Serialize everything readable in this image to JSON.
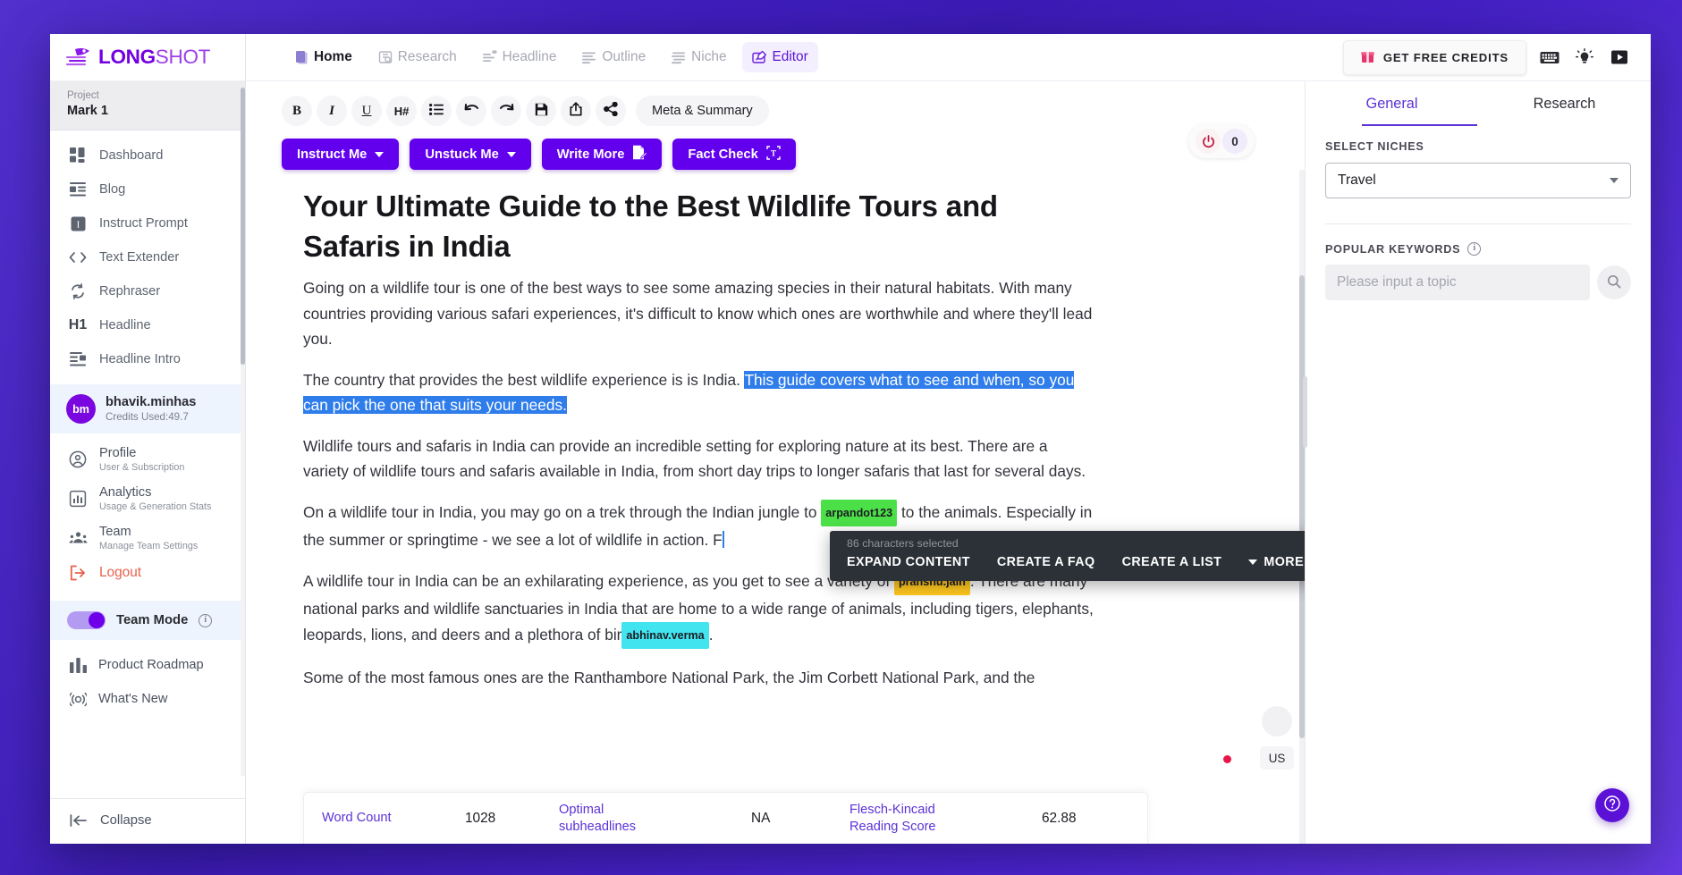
{
  "brand": {
    "name_bold": "LONG",
    "name_light": "SHOT",
    "accent": "#7200e0"
  },
  "sidebar": {
    "project_label": "Project",
    "project_name": "Mark 1",
    "nav": [
      {
        "label": "Dashboard",
        "icon": "dashboard-icon"
      },
      {
        "label": "Blog",
        "icon": "blog-icon"
      },
      {
        "label": "Instruct Prompt",
        "icon": "instruct-prompt-icon"
      },
      {
        "label": "Text Extender",
        "icon": "code-brackets-icon"
      },
      {
        "label": "Rephraser",
        "icon": "refresh-icon"
      },
      {
        "label": "Headline",
        "icon": "h1-icon"
      },
      {
        "label": "Headline Intro",
        "icon": "headline-intro-icon"
      }
    ],
    "user": {
      "initials": "bm",
      "name": "bhavik.minhas",
      "credits": "Credits Used:49.7"
    },
    "account": [
      {
        "title": "Profile",
        "subtitle": "User & Subscription",
        "icon": "user-circle-icon"
      },
      {
        "title": "Analytics",
        "subtitle": "Usage & Generation Stats",
        "icon": "chart-box-icon"
      },
      {
        "title": "Team",
        "subtitle": "Manage Team Settings",
        "icon": "team-icon"
      }
    ],
    "logout": {
      "title": "Logout",
      "icon": "logout-icon"
    },
    "team_mode": {
      "label": "Team Mode",
      "enabled": true
    },
    "bottom": [
      {
        "label": "Product Roadmap",
        "icon": "roadmap-icon"
      },
      {
        "label": "What's New",
        "icon": "megaphone-icon"
      }
    ],
    "collapse": {
      "label": "Collapse",
      "icon": "arrow-left-bar-icon"
    }
  },
  "topbar": {
    "tabs": [
      {
        "label": "Home",
        "icon": "home-icon",
        "state": "home"
      },
      {
        "label": "Research",
        "icon": "research-icon",
        "state": "idle"
      },
      {
        "label": "Headline",
        "icon": "headline-icon",
        "state": "idle"
      },
      {
        "label": "Outline",
        "icon": "outline-icon",
        "state": "idle"
      },
      {
        "label": "Niche",
        "icon": "niche-icon",
        "state": "idle"
      },
      {
        "label": "Editor",
        "icon": "editor-icon",
        "state": "active"
      }
    ],
    "credits_button": {
      "label": "GET FREE CREDITS",
      "icon": "gift-icon"
    },
    "icons": [
      {
        "name": "keyboard-icon"
      },
      {
        "name": "lightbulb-icon"
      },
      {
        "name": "play-video-icon"
      }
    ]
  },
  "toolbar": {
    "buttons": [
      {
        "label": "B",
        "name": "bold-button"
      },
      {
        "label": "I",
        "name": "italic-button"
      },
      {
        "label": "U",
        "name": "underline-button"
      },
      {
        "label": "H#",
        "name": "heading-button"
      },
      {
        "label": "list-icon",
        "name": "bullet-list-button"
      },
      {
        "label": "undo-icon",
        "name": "undo-button"
      },
      {
        "label": "redo-icon",
        "name": "redo-button"
      },
      {
        "label": "save-icon",
        "name": "save-button"
      },
      {
        "label": "export-icon",
        "name": "export-button"
      },
      {
        "label": "share-icon",
        "name": "share-button"
      }
    ],
    "meta_label": "Meta & Summary"
  },
  "actions": [
    {
      "label": "Instruct Me",
      "trailing": "caret"
    },
    {
      "label": "Unstuck Me",
      "trailing": "caret"
    },
    {
      "label": "Write More",
      "trailing": "write-icon"
    },
    {
      "label": "Fact Check",
      "trailing": "fact-check-icon"
    }
  ],
  "power_pill": {
    "icon": "power-icon",
    "count": "0"
  },
  "document": {
    "title": "Your Ultimate Guide to the Best Wildlife Tours and Safaris in India",
    "p1": "Going on a wildlife tour is one of the best ways to see some amazing species in their natural habitats. With many countries providing various safari experiences, it's difficult to know which ones are worthwhile and where they'll lead you.",
    "p2_pre": "The country that provides the best wildlife experience is ",
    "p2_err": "is",
    "p2_mid": " India. ",
    "p2_sel": "This guide covers what to see and when, so you can pick the one that suits your needs.",
    "p3": "Wildlife tours and safaris in India can provide an incredible setting for exploring nature at its best. There are a variety of wildlife tours and safaris available in India, from short day trips to longer safaris that last for several days.",
    "p4_a": "On a wildlife tour in India, you may go on a trek through the Indian jungle to",
    "p4_tag": "arpandot123",
    "p4_b": "to the animals. Especially in the summer or springtime - we see a lot of wildlife in action. F",
    "p5_a": "A wildlife tour in India can be an exhilarating experience, as you get to see a variety of",
    "p5_tag": "pranshu.jain",
    "p5_b": ". There are many national parks and wildlife sanctuaries in India that are home to a wide range of animals, including tigers, elephants, leopards, lions, and deers and a plethora of  bir",
    "p5_tag2": "abhinav.verma",
    "p5_c": ".",
    "p6": "Some of the most famous ones are the Ranthambore National Park, the Jim Corbett National Park, and the"
  },
  "selection_popover": {
    "count_text": "86 characters selected",
    "actions": [
      "EXPAND CONTENT",
      "CREATE A FAQ",
      "CREATE A LIST"
    ],
    "more_label": "MORE"
  },
  "stats": [
    {
      "label": "Word Count",
      "value": "1028"
    },
    {
      "label": "Optimal subheadlines",
      "value": "NA"
    },
    {
      "label": "Flesch-Kincaid Reading Score",
      "value": "62.88"
    }
  ],
  "locale_chip": "US",
  "right_panel": {
    "tabs": [
      {
        "label": "General",
        "active": true
      },
      {
        "label": "Research",
        "active": false
      }
    ],
    "niches_label": "SELECT NICHES",
    "niche_value": "Travel",
    "keywords_label": "POPULAR KEYWORDS",
    "keyword_placeholder": "Please input a topic",
    "keyword_value": ""
  },
  "help_fab": {
    "icon": "question-mark-icon"
  }
}
